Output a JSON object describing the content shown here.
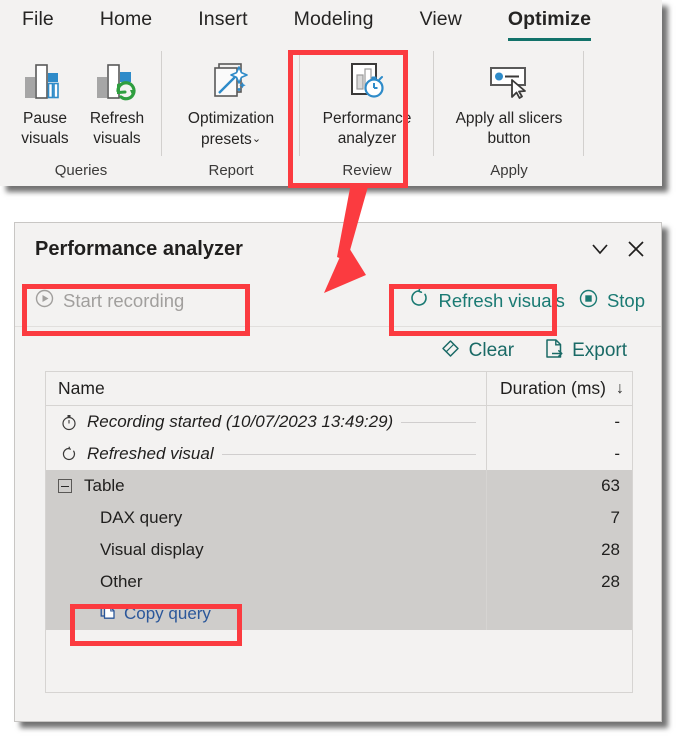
{
  "colors": {
    "accent_green": "#12726a",
    "teal_command": "#1a7a73",
    "link_blue": "#2b579a",
    "annotation_red": "#fb3b40",
    "disabled_grey": "#a19f9d",
    "ribbon_bg": "#f3f2f1",
    "row_selected": "#cfcdcb"
  },
  "ribbon": {
    "tabs": [
      {
        "label": "File",
        "active": false
      },
      {
        "label": "Home",
        "active": false
      },
      {
        "label": "Insert",
        "active": false
      },
      {
        "label": "Modeling",
        "active": false
      },
      {
        "label": "View",
        "active": false
      },
      {
        "label": "Optimize",
        "active": true
      }
    ],
    "groups": [
      {
        "label": "Queries",
        "buttons": [
          {
            "label": "Pause\nvisuals",
            "icon": "bar-chart-pause-icon"
          },
          {
            "label": "Refresh\nvisuals",
            "icon": "bar-chart-refresh-icon"
          }
        ]
      },
      {
        "label": "Report",
        "buttons": [
          {
            "label": "Optimization\npresets",
            "icon": "magic-wand-presets-icon",
            "has_chevron": true
          }
        ]
      },
      {
        "label": "Review",
        "buttons": [
          {
            "label": "Performance\nanalyzer",
            "icon": "stopwatch-report-icon"
          }
        ]
      },
      {
        "label": "Apply",
        "buttons": [
          {
            "label": "Apply all slicers\nbutton",
            "icon": "slicer-cursor-icon"
          }
        ]
      }
    ],
    "chevron_glyph": "ˇ"
  },
  "panel": {
    "title": "Performance analyzer",
    "header_icons": [
      {
        "name": "collapse-chevron-icon"
      },
      {
        "name": "close-icon"
      }
    ],
    "commands": {
      "start_recording": {
        "label": "Start recording",
        "icon": "play-circle-icon",
        "enabled": false
      },
      "refresh_visuals": {
        "label": "Refresh visuals",
        "icon": "refresh-circle-icon",
        "enabled": true
      },
      "stop": {
        "label": "Stop",
        "icon": "stop-circle-icon",
        "enabled": true
      }
    },
    "toolbar": {
      "clear": {
        "label": "Clear",
        "icon": "eraser-icon"
      },
      "export": {
        "label": "Export",
        "icon": "export-page-icon"
      }
    },
    "table": {
      "headers": {
        "name": "Name",
        "duration": "Duration (ms)"
      },
      "sort_arrow": "↓",
      "rows": [
        {
          "type": "event",
          "icon": "stopwatch-icon",
          "name": "Recording started (10/07/2023 13:49:29)",
          "duration": "-",
          "italic": true,
          "selected": false
        },
        {
          "type": "event",
          "icon": "refresh-icon",
          "name": "Refreshed visual",
          "duration": "-",
          "italic": true,
          "selected": false
        },
        {
          "type": "group",
          "icon": "collapse-box-icon",
          "name": "Table",
          "duration": "63",
          "italic": false,
          "selected": true
        },
        {
          "type": "detail",
          "name": "DAX query",
          "duration": "7",
          "italic": false,
          "selected": true
        },
        {
          "type": "detail",
          "name": "Visual display",
          "duration": "28",
          "italic": false,
          "selected": true
        },
        {
          "type": "detail",
          "name": "Other",
          "duration": "28",
          "italic": false,
          "selected": true
        },
        {
          "type": "link",
          "icon": "copy-icon",
          "name": "Copy query",
          "duration": "",
          "italic": false,
          "selected": true
        }
      ]
    }
  },
  "annotations": {
    "highlight_boxes": [
      {
        "name": "performance-analyzer-ribbon-highlight"
      },
      {
        "name": "start-recording-highlight"
      },
      {
        "name": "refresh-visuals-highlight"
      },
      {
        "name": "copy-query-highlight"
      }
    ],
    "arrow": {
      "name": "pointer-arrow",
      "direction": "down-left"
    }
  }
}
